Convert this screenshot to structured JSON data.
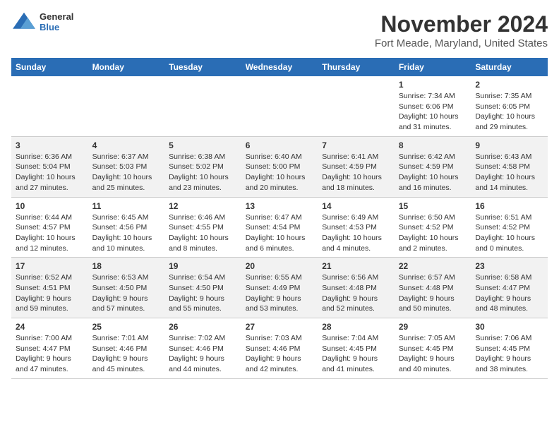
{
  "logo": {
    "general": "General",
    "blue": "Blue"
  },
  "title": "November 2024",
  "subtitle": "Fort Meade, Maryland, United States",
  "days_of_week": [
    "Sunday",
    "Monday",
    "Tuesday",
    "Wednesday",
    "Thursday",
    "Friday",
    "Saturday"
  ],
  "weeks": [
    [
      {
        "day": "",
        "info": ""
      },
      {
        "day": "",
        "info": ""
      },
      {
        "day": "",
        "info": ""
      },
      {
        "day": "",
        "info": ""
      },
      {
        "day": "",
        "info": ""
      },
      {
        "day": "1",
        "info": "Sunrise: 7:34 AM\nSunset: 6:06 PM\nDaylight: 10 hours and 31 minutes."
      },
      {
        "day": "2",
        "info": "Sunrise: 7:35 AM\nSunset: 6:05 PM\nDaylight: 10 hours and 29 minutes."
      }
    ],
    [
      {
        "day": "3",
        "info": "Sunrise: 6:36 AM\nSunset: 5:04 PM\nDaylight: 10 hours and 27 minutes."
      },
      {
        "day": "4",
        "info": "Sunrise: 6:37 AM\nSunset: 5:03 PM\nDaylight: 10 hours and 25 minutes."
      },
      {
        "day": "5",
        "info": "Sunrise: 6:38 AM\nSunset: 5:02 PM\nDaylight: 10 hours and 23 minutes."
      },
      {
        "day": "6",
        "info": "Sunrise: 6:40 AM\nSunset: 5:00 PM\nDaylight: 10 hours and 20 minutes."
      },
      {
        "day": "7",
        "info": "Sunrise: 6:41 AM\nSunset: 4:59 PM\nDaylight: 10 hours and 18 minutes."
      },
      {
        "day": "8",
        "info": "Sunrise: 6:42 AM\nSunset: 4:59 PM\nDaylight: 10 hours and 16 minutes."
      },
      {
        "day": "9",
        "info": "Sunrise: 6:43 AM\nSunset: 4:58 PM\nDaylight: 10 hours and 14 minutes."
      }
    ],
    [
      {
        "day": "10",
        "info": "Sunrise: 6:44 AM\nSunset: 4:57 PM\nDaylight: 10 hours and 12 minutes."
      },
      {
        "day": "11",
        "info": "Sunrise: 6:45 AM\nSunset: 4:56 PM\nDaylight: 10 hours and 10 minutes."
      },
      {
        "day": "12",
        "info": "Sunrise: 6:46 AM\nSunset: 4:55 PM\nDaylight: 10 hours and 8 minutes."
      },
      {
        "day": "13",
        "info": "Sunrise: 6:47 AM\nSunset: 4:54 PM\nDaylight: 10 hours and 6 minutes."
      },
      {
        "day": "14",
        "info": "Sunrise: 6:49 AM\nSunset: 4:53 PM\nDaylight: 10 hours and 4 minutes."
      },
      {
        "day": "15",
        "info": "Sunrise: 6:50 AM\nSunset: 4:52 PM\nDaylight: 10 hours and 2 minutes."
      },
      {
        "day": "16",
        "info": "Sunrise: 6:51 AM\nSunset: 4:52 PM\nDaylight: 10 hours and 0 minutes."
      }
    ],
    [
      {
        "day": "17",
        "info": "Sunrise: 6:52 AM\nSunset: 4:51 PM\nDaylight: 9 hours and 59 minutes."
      },
      {
        "day": "18",
        "info": "Sunrise: 6:53 AM\nSunset: 4:50 PM\nDaylight: 9 hours and 57 minutes."
      },
      {
        "day": "19",
        "info": "Sunrise: 6:54 AM\nSunset: 4:50 PM\nDaylight: 9 hours and 55 minutes."
      },
      {
        "day": "20",
        "info": "Sunrise: 6:55 AM\nSunset: 4:49 PM\nDaylight: 9 hours and 53 minutes."
      },
      {
        "day": "21",
        "info": "Sunrise: 6:56 AM\nSunset: 4:48 PM\nDaylight: 9 hours and 52 minutes."
      },
      {
        "day": "22",
        "info": "Sunrise: 6:57 AM\nSunset: 4:48 PM\nDaylight: 9 hours and 50 minutes."
      },
      {
        "day": "23",
        "info": "Sunrise: 6:58 AM\nSunset: 4:47 PM\nDaylight: 9 hours and 48 minutes."
      }
    ],
    [
      {
        "day": "24",
        "info": "Sunrise: 7:00 AM\nSunset: 4:47 PM\nDaylight: 9 hours and 47 minutes."
      },
      {
        "day": "25",
        "info": "Sunrise: 7:01 AM\nSunset: 4:46 PM\nDaylight: 9 hours and 45 minutes."
      },
      {
        "day": "26",
        "info": "Sunrise: 7:02 AM\nSunset: 4:46 PM\nDaylight: 9 hours and 44 minutes."
      },
      {
        "day": "27",
        "info": "Sunrise: 7:03 AM\nSunset: 4:46 PM\nDaylight: 9 hours and 42 minutes."
      },
      {
        "day": "28",
        "info": "Sunrise: 7:04 AM\nSunset: 4:45 PM\nDaylight: 9 hours and 41 minutes."
      },
      {
        "day": "29",
        "info": "Sunrise: 7:05 AM\nSunset: 4:45 PM\nDaylight: 9 hours and 40 minutes."
      },
      {
        "day": "30",
        "info": "Sunrise: 7:06 AM\nSunset: 4:45 PM\nDaylight: 9 hours and 38 minutes."
      }
    ]
  ]
}
